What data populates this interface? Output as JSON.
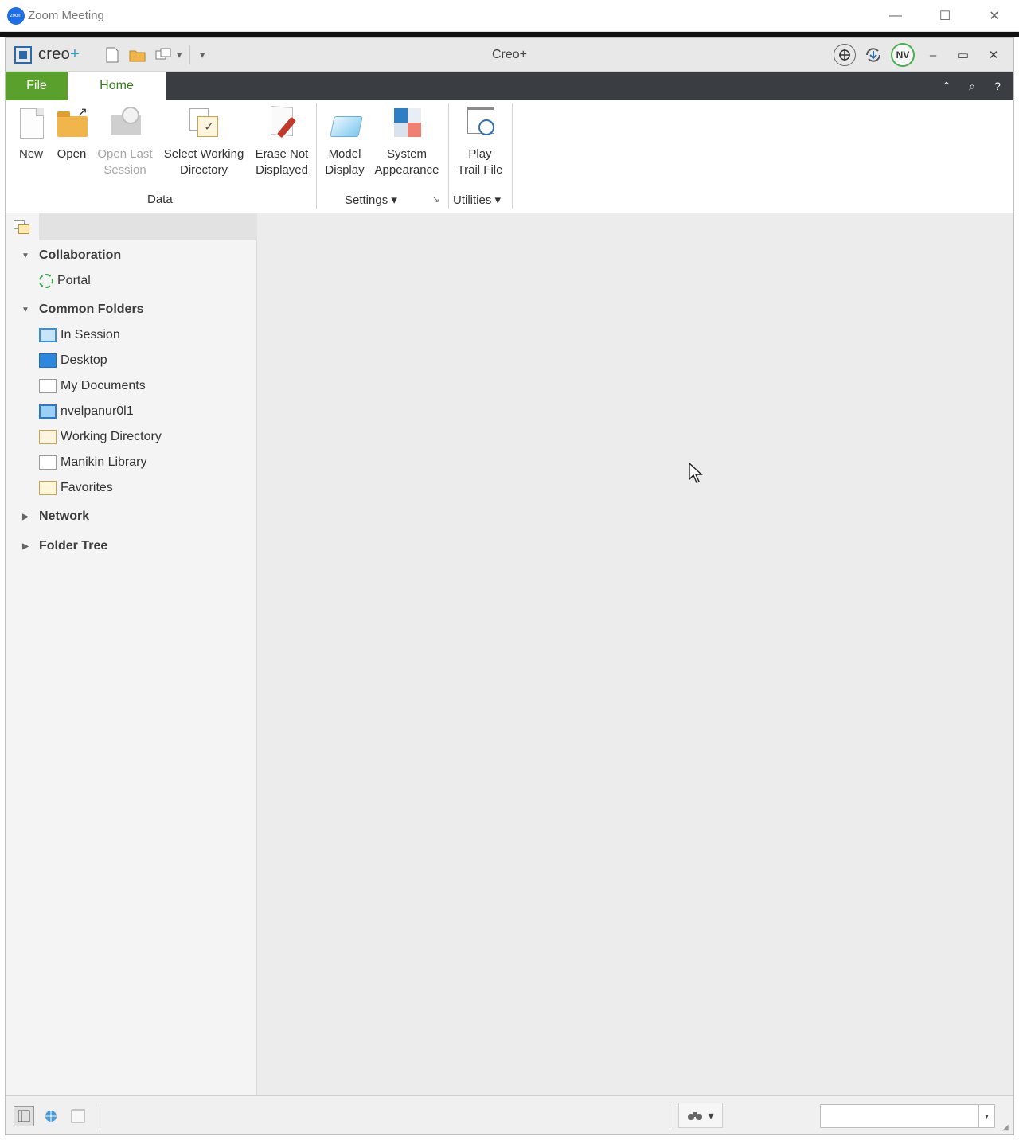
{
  "zoom": {
    "title": "Zoom Meeting",
    "logo_text": "zoom",
    "minimize": "—",
    "maximize": "☐",
    "close": "✕"
  },
  "creo": {
    "brand": "creo",
    "brand_plus": "+",
    "window_title": "Creo+",
    "avatar": "NV",
    "qat_dropdown": "▾",
    "qat_customize": "▾",
    "win_minimize": "–",
    "win_maximize": "▭",
    "win_close": "✕"
  },
  "tabs": {
    "file": "File",
    "home": "Home",
    "collapse": "⌃",
    "search": "⌕",
    "help": "?"
  },
  "ribbon": {
    "data_group": "Data",
    "settings_group": "Settings ▾",
    "utilities_group": "Utilities ▾",
    "launcher": "↘",
    "buttons": {
      "new": "New",
      "open": "Open",
      "open_last_1": "Open Last",
      "open_last_2": "Session",
      "swd_1": "Select Working",
      "swd_2": "Directory",
      "erase_1": "Erase Not",
      "erase_2": "Displayed",
      "model_1": "Model",
      "model_2": "Display",
      "sys_1": "System",
      "sys_2": "Appearance",
      "play_1": "Play",
      "play_2": "Trail File"
    }
  },
  "navigator": {
    "collaboration": "Collaboration",
    "portal": "Portal",
    "common_folders": "Common Folders",
    "in_session": "In Session",
    "desktop": "Desktop",
    "my_documents": "My Documents",
    "computer": "nvelpanur0l1",
    "working_directory": "Working Directory",
    "manikin_library": "Manikin Library",
    "favorites": "Favorites",
    "network": "Network",
    "folder_tree": "Folder Tree",
    "expanded_caret": "▼",
    "collapsed_caret": "▶"
  },
  "status": {
    "dropdown_arrow": "▾"
  },
  "icons": {
    "pointer": "cursor-pointer-icon"
  }
}
